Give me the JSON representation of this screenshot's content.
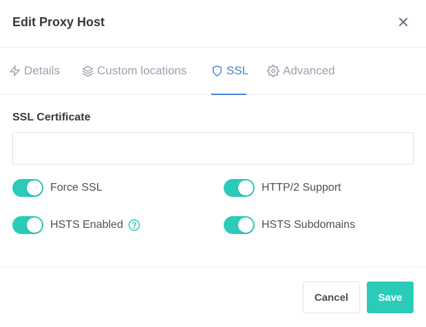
{
  "modal": {
    "title": "Edit Proxy Host",
    "close_icon": "close-icon"
  },
  "tabs": [
    {
      "label": "Details",
      "icon": "bolt-icon",
      "active": false
    },
    {
      "label": "Custom locations",
      "icon": "layers-icon",
      "active": false
    },
    {
      "label": "SSL",
      "icon": "shield-icon",
      "active": true
    },
    {
      "label": "Advanced",
      "icon": "gear-icon",
      "active": false
    }
  ],
  "ssl": {
    "certificate_label": "SSL Certificate",
    "certificate_value": "",
    "toggles": [
      {
        "label": "Force SSL",
        "enabled": true
      },
      {
        "label": "HTTP/2 Support",
        "enabled": true
      },
      {
        "label": "HSTS Enabled",
        "enabled": true,
        "help_icon": "help-circle-icon"
      },
      {
        "label": "HSTS Subdomains",
        "enabled": true
      }
    ]
  },
  "footer": {
    "cancel_label": "Cancel",
    "save_label": "Save"
  },
  "colors": {
    "accent_teal": "#2bcbba",
    "active_tab_blue": "#467fcf",
    "muted_text": "#9aa0ac"
  }
}
